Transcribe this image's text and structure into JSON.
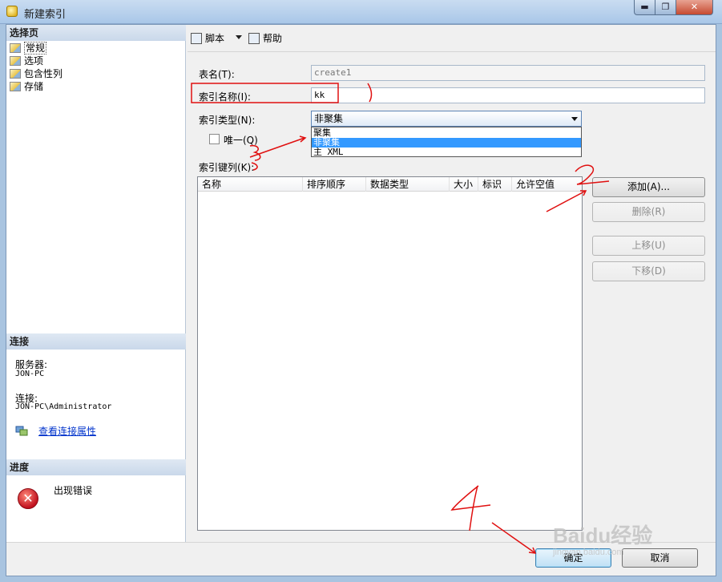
{
  "window": {
    "title": "新建索引",
    "buttons": {
      "minimize": "▬",
      "maximize": "❐",
      "close": "✕"
    }
  },
  "sidebar": {
    "select_page": {
      "heading": "选择页",
      "items": [
        {
          "label": "常规",
          "icon": "page-wrench-icon",
          "selected": true
        },
        {
          "label": "选项",
          "icon": "page-wrench-icon"
        },
        {
          "label": "包含性列",
          "icon": "page-wrench-icon"
        },
        {
          "label": "存储",
          "icon": "page-wrench-icon"
        }
      ]
    },
    "connection": {
      "heading": "连接",
      "server_label": "服务器:",
      "server_value": "JON-PC",
      "connection_label": "连接:",
      "connection_value": "JON-PC\\Administrator",
      "properties_link": "查看连接属性"
    },
    "progress": {
      "heading": "进度",
      "status": "出现错误",
      "status_icon": "error-icon"
    }
  },
  "toolbar": {
    "script_label": "脚本",
    "help_label": "帮助"
  },
  "form": {
    "table_name_label": "表名(T):",
    "table_name_value": "create1",
    "index_name_label": "索引名称(I):",
    "index_name_value": "kk",
    "index_type_label": "索引类型(N):",
    "index_type_selected": "非聚集",
    "index_type_options": [
      "聚集",
      "非聚集",
      "主 XML"
    ],
    "unique_label": "唯一(Q)",
    "unique_checked": false,
    "key_columns_label": "索引键列(K):",
    "columns_headers": [
      "名称",
      "排序顺序",
      "数据类型",
      "大小",
      "标识",
      "允许空值"
    ]
  },
  "actions": {
    "add": "添加(A)...",
    "remove": "删除(R)",
    "move_up": "上移(U)",
    "move_down": "下移(D)"
  },
  "footer": {
    "ok": "确定",
    "cancel": "取消"
  },
  "annotations": {
    "step1": "1",
    "step2": "2",
    "step3": "3",
    "step4": "4",
    "color": "#e01010"
  },
  "watermark": {
    "text": "Baidu经验",
    "url": "jingyan.baidu.com"
  }
}
